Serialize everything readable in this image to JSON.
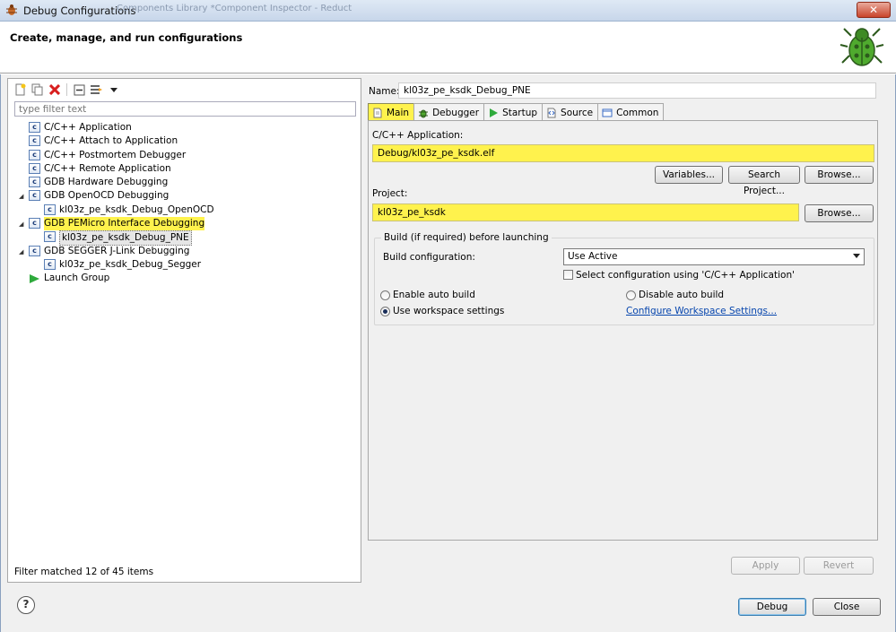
{
  "window": {
    "title": "Debug Configurations",
    "background_tabs": "Components Library    *Component Inspector - Reduct",
    "close_glyph": "✕"
  },
  "header": {
    "title": "Create, manage, and run configurations",
    "icon": "bug-icon"
  },
  "left": {
    "toolbar": [
      {
        "name": "new-configuration-icon",
        "glyph": "✦"
      },
      {
        "name": "duplicate-icon",
        "glyph": "▣"
      },
      {
        "name": "delete-icon",
        "glyph": "✖"
      },
      {
        "name": "collapse-all-icon",
        "glyph": "⊟"
      },
      {
        "name": "filter-icon",
        "glyph": "⚟"
      },
      {
        "name": "dropdown-arrow-icon",
        "glyph": "▾"
      }
    ],
    "filter_placeholder": "type filter text",
    "tree": [
      {
        "label": "C/C++ Application",
        "level": 0,
        "icon": "c",
        "twisty": ""
      },
      {
        "label": "C/C++ Attach to Application",
        "level": 0,
        "icon": "c",
        "twisty": ""
      },
      {
        "label": "C/C++ Postmortem Debugger",
        "level": 0,
        "icon": "c",
        "twisty": ""
      },
      {
        "label": "C/C++ Remote Application",
        "level": 0,
        "icon": "c",
        "twisty": ""
      },
      {
        "label": "GDB Hardware Debugging",
        "level": 0,
        "icon": "c",
        "twisty": ""
      },
      {
        "label": "GDB OpenOCD Debugging",
        "level": 0,
        "icon": "c",
        "twisty": "◢"
      },
      {
        "label": "kl03z_pe_ksdk_Debug_OpenOCD",
        "level": 1,
        "icon": "c",
        "twisty": ""
      },
      {
        "label": "GDB PEMicro Interface Debugging",
        "level": 0,
        "icon": "c",
        "twisty": "◢",
        "highlight": true
      },
      {
        "label": "kl03z_pe_ksdk_Debug_PNE",
        "level": 1,
        "icon": "c",
        "twisty": "",
        "selected": true
      },
      {
        "label": "GDB SEGGER J-Link Debugging",
        "level": 0,
        "icon": "c",
        "twisty": "◢"
      },
      {
        "label": "kl03z_pe_ksdk_Debug_Segger",
        "level": 1,
        "icon": "c",
        "twisty": ""
      },
      {
        "label": "Launch Group",
        "level": 0,
        "icon": "launch",
        "twisty": ""
      }
    ],
    "status": "Filter matched 12 of 45 items"
  },
  "right": {
    "name_label": "Name:",
    "name_value": "kl03z_pe_ksdk_Debug_PNE",
    "tabs": [
      {
        "label": "Main",
        "icon": "main-tab-icon",
        "active": true
      },
      {
        "label": "Debugger",
        "icon": "debugger-tab-icon",
        "active": false
      },
      {
        "label": "Startup",
        "icon": "startup-tab-icon",
        "active": false
      },
      {
        "label": "Source",
        "icon": "source-tab-icon",
        "active": false
      },
      {
        "label": "Common",
        "icon": "common-tab-icon",
        "active": false
      }
    ],
    "app_label": "C/C++ Application:",
    "app_value": "Debug/kl03z_pe_ksdk.elf",
    "variables_btn": "Variables...",
    "search_project_btn": "Search Project...",
    "browse_btn": "Browse...",
    "project_label": "Project:",
    "project_value": "kl03z_pe_ksdk",
    "build_group_title": "Build (if required) before launching",
    "build_config_label": "Build configuration:",
    "build_config_value": "Use Active",
    "select_config_label": "Select configuration using 'C/C++ Application'",
    "enable_auto_build": "Enable auto build",
    "disable_auto_build": "Disable auto build",
    "use_workspace": "Use workspace settings",
    "configure_workspace_link": "Configure Workspace Settings...",
    "apply_btn": "Apply",
    "revert_btn": "Revert"
  },
  "footer": {
    "help_glyph": "?",
    "debug_btn": "Debug",
    "close_btn": "Close"
  },
  "colors": {
    "highlight": "#fff24d",
    "link": "#0645ad"
  }
}
